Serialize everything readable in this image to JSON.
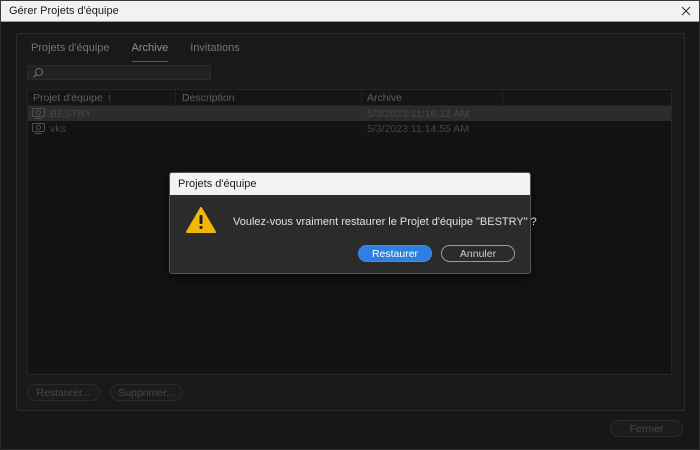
{
  "window": {
    "title": "Gérer Projets d'équipe",
    "close_label": "×"
  },
  "tabs": [
    {
      "label": "Projets d'équipe",
      "active": false
    },
    {
      "label": "Archive",
      "active": true
    },
    {
      "label": "Invitations",
      "active": false
    }
  ],
  "search": {
    "value": "",
    "placeholder": ""
  },
  "table": {
    "headers": {
      "project": "Projet d'équipe",
      "description": "Description",
      "archive": "Archive"
    },
    "sort_indicator": "↑",
    "rows": [
      {
        "project": "BESTRY",
        "description": "",
        "archive": "5/3/2023 11:16:12 AM",
        "selected": true
      },
      {
        "project": "vks",
        "description": "",
        "archive": "5/3/2023 11:14:55 AM",
        "selected": false
      }
    ]
  },
  "actions": {
    "restore_label": "Restaurer...",
    "delete_label": "Supprimer...",
    "close_label": "Fermer"
  },
  "dialog": {
    "title": "Projets d'équipe",
    "message": "Voulez-vous vraiment restaurer le Projet d'équipe \"BESTRY\" ?",
    "ok_label": "Restaurer",
    "cancel_label": "Annuler"
  },
  "colors": {
    "accent": "#2f7fe0",
    "warning": "#f2b705"
  }
}
